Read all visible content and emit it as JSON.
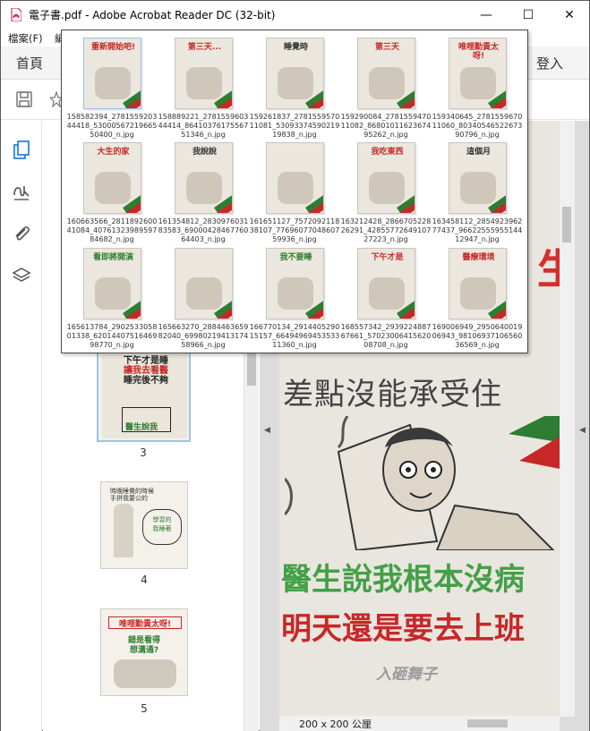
{
  "window": {
    "title": "電子書.pdf - Adobe Acrobat Reader DC (32-bit)",
    "minimize": "—",
    "maximize": "☐",
    "close": "✕"
  },
  "menu": {
    "file": "檔案(F)",
    "edit": "編"
  },
  "tabs": {
    "home": "首頁",
    "signin": "登入"
  },
  "thumbnails": {
    "pages": [
      "3",
      "4",
      "5"
    ]
  },
  "document": {
    "line_top": "差點沒能承受住",
    "line_green": "醫生說我根本沒病",
    "line_red": "明天還是要去上班",
    "big_red": "生",
    "watermark": "入砸舞子",
    "page_size": "200 x 200 公厘"
  },
  "files": [
    {
      "name": "158582394_278155920344418_5300056721966550400_n.jpg",
      "caption": "重新開始吧!",
      "color": "#c62828"
    },
    {
      "name": "158889221_278155960344414_8641037617556751346_n.jpg",
      "caption": "第三天...",
      "color": "#c62828"
    },
    {
      "name": "159261837_278155957011081_5309337459021919838_n.jpg",
      "caption": "睡覺時",
      "color": "#333333"
    },
    {
      "name": "159290084_278155947011082_8680101162367495262_n.jpg",
      "caption": "第三天",
      "color": "#c62828"
    },
    {
      "name": "159340645_278155967011060_8034054652267390796_n.jpg",
      "caption": "唯哩勤責太呀!",
      "color": "#c62828"
    },
    {
      "name": "160663566_281189260041084_4076132398959784682_n.jpg",
      "caption": "大生的家",
      "color": "#c62828"
    },
    {
      "name": "161354812_283097603183583_6900042846776064403_n.jpg",
      "caption": "我說說",
      "color": "#333333"
    },
    {
      "name": "161651127_757209211838107_7769607704860759936_n.jpg",
      "caption": "",
      "color": "#333333"
    },
    {
      "name": "163212428_286670522826291_4285577264910727223_n.jpg",
      "caption": "我吃東西",
      "color": "#c62828"
    },
    {
      "name": "163458112_285492396277437_9662255595514412947_n.jpg",
      "caption": "這個月",
      "color": "#333333"
    },
    {
      "name": "165613784_290253305801338_6201440751646998770_n.jpg",
      "caption": "看即將開演",
      "color": "#2e7d32"
    },
    {
      "name": "165663270_288446365982040_6998021941317458966_n.jpg",
      "caption": "",
      "color": "#333333"
    },
    {
      "name": "166770134_291440529015157_6649496945353311360_n.jpg",
      "caption": "我不要睡",
      "color": "#2e7d32"
    },
    {
      "name": "168557342_293922488767661_5702300641562008708_n.jpg",
      "caption": "下午才是",
      "color": "#c62828"
    },
    {
      "name": "169006949_295064001906943_9810693710656036569_n.jpg",
      "caption": "醫療環境",
      "color": "#c62828"
    }
  ],
  "icons": {
    "save": "save-icon",
    "star": "star-icon",
    "pages": "pages-icon",
    "sign": "sign-icon",
    "attach": "paperclip-icon",
    "layers": "layers-icon"
  }
}
